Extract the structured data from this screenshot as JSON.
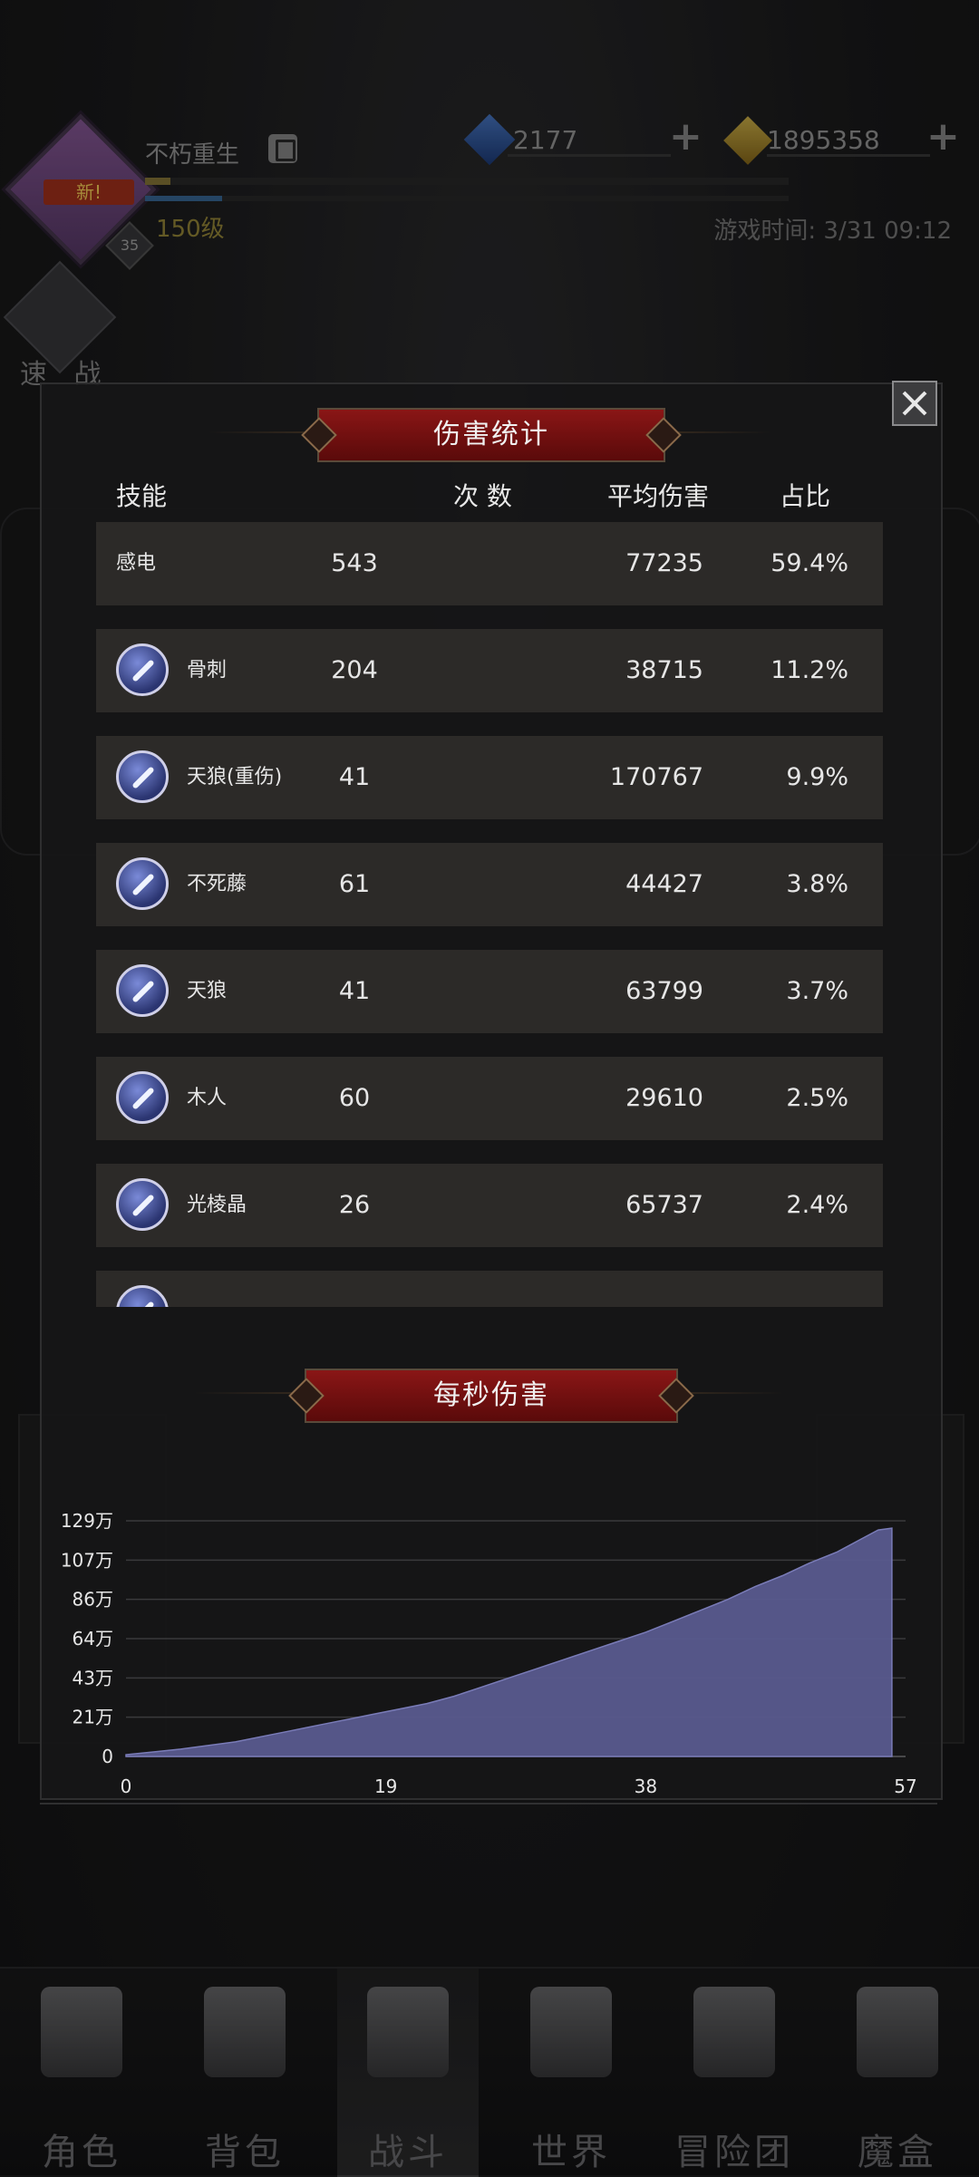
{
  "player": {
    "name": "不朽重生",
    "level": "150级",
    "avatar_badge": "新!",
    "avatar_level": "35",
    "exp_fraction": 0.04,
    "mp_fraction": 0.12
  },
  "resources": {
    "gems": "2177",
    "gold": "1895358"
  },
  "game_time": "游戏时间: 3/31 09:12",
  "quick_battle_label": "速 战",
  "damage_stats": {
    "title": "伤害统计",
    "headers": {
      "skill": "技能",
      "count": "次 数",
      "avg": "平均伤害",
      "pct": "占比"
    },
    "rows": [
      {
        "skill": "感电",
        "count": "543",
        "avg": "77235",
        "pct": "59.4%",
        "icon": "none"
      },
      {
        "skill": "骨刺",
        "count": "204",
        "avg": "38715",
        "pct": "11.2%",
        "icon": "bone-spike-icon"
      },
      {
        "skill": "天狼(重伤)",
        "count": "41",
        "avg": "170767",
        "pct": "9.9%",
        "icon": "sword-icon"
      },
      {
        "skill": "不死藤",
        "count": "61",
        "avg": "44427",
        "pct": "3.8%",
        "icon": "vine-icon"
      },
      {
        "skill": "天狼",
        "count": "41",
        "avg": "63799",
        "pct": "3.7%",
        "icon": "wolf-fang-icon"
      },
      {
        "skill": "木人",
        "count": "60",
        "avg": "29610",
        "pct": "2.5%",
        "icon": "wood-dummy-icon"
      },
      {
        "skill": "光棱晶",
        "count": "26",
        "avg": "65737",
        "pct": "2.4%",
        "icon": "prism-crystal-icon"
      }
    ]
  },
  "chart_data": {
    "type": "area",
    "title": "每秒伤害",
    "xlabel": "",
    "ylabel": "",
    "x_ticks": [
      "0",
      "19",
      "38",
      "57"
    ],
    "y_ticks": [
      "0",
      "21万",
      "43万",
      "64万",
      "86万",
      "107万",
      "129万"
    ],
    "xlim": [
      0,
      57
    ],
    "ylim": [
      0,
      129
    ],
    "color": "#585a8e",
    "x": [
      0,
      2,
      4,
      6,
      8,
      10,
      12,
      14,
      16,
      18,
      20,
      22,
      24,
      26,
      28,
      30,
      32,
      34,
      36,
      38,
      40,
      42,
      44,
      46,
      48,
      50,
      52,
      54,
      55,
      56
    ],
    "values": [
      1,
      2.5,
      4,
      6,
      8,
      11,
      14,
      17,
      20,
      23,
      26,
      29,
      33,
      38,
      43,
      48,
      53,
      58,
      63,
      68,
      74,
      80,
      86,
      93,
      99,
      106,
      112,
      120,
      124,
      125
    ]
  },
  "bottom_nav": [
    {
      "label": "角色"
    },
    {
      "label": "背包"
    },
    {
      "label": "战斗"
    },
    {
      "label": "世界"
    },
    {
      "label": "冒险团"
    },
    {
      "label": "魔盒"
    }
  ]
}
